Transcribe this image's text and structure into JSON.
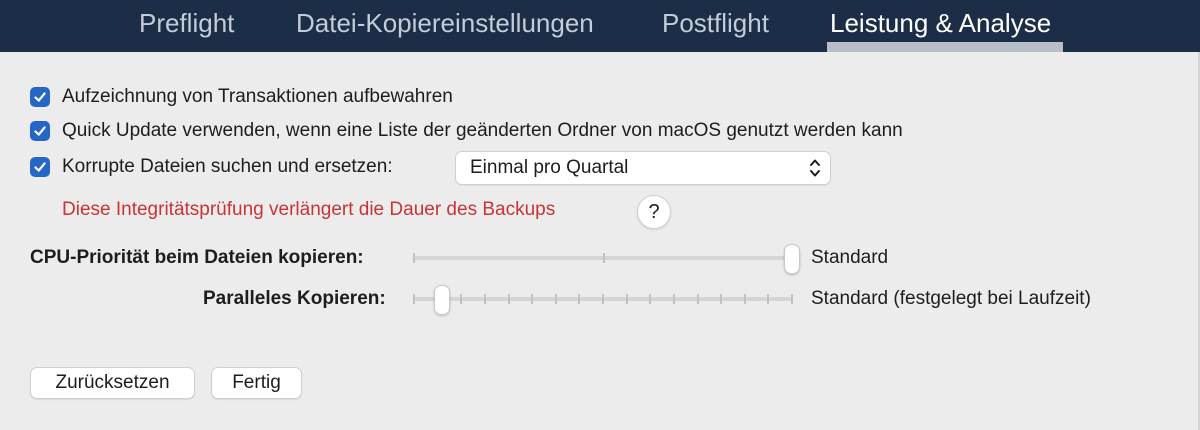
{
  "tabs": [
    {
      "label": "Preflight",
      "active": false
    },
    {
      "label": "Datei-Kopiereinstellungen",
      "active": false
    },
    {
      "label": "Postflight",
      "active": false
    },
    {
      "label": "Leistung & Analyse",
      "active": true
    }
  ],
  "options": {
    "keep_transaction_log": {
      "label": "Aufzeichnung von Transaktionen aufbewahren",
      "checked": true
    },
    "quick_update": {
      "label": "Quick Update verwenden, wenn eine Liste der geänderten Ordner von macOS genutzt werden kann",
      "checked": true
    },
    "corrupt_files": {
      "label": "Korrupte Dateien suchen und ersetzen:",
      "checked": true,
      "frequency": "Einmal pro Quartal"
    }
  },
  "warning": {
    "text": "Diese Integritätsprüfung verlängert die Dauer des Backups",
    "help_glyph": "?"
  },
  "sliders": {
    "cpu_priority": {
      "label": "CPU-Priorität beim Dateien kopieren:",
      "value_text": "Standard",
      "level": 1.0,
      "ticks": 3
    },
    "parallel_copy": {
      "label": "Paralleles Kopieren:",
      "value_text": "Standard (festgelegt bei Laufzeit)",
      "level": 0.0,
      "ticks": 17
    }
  },
  "buttons": {
    "reset": "Zurücksetzen",
    "done": "Fertig"
  },
  "colors": {
    "accent": "#2467c7",
    "warning": "#c93434",
    "tabbar": "#1c2e47"
  }
}
